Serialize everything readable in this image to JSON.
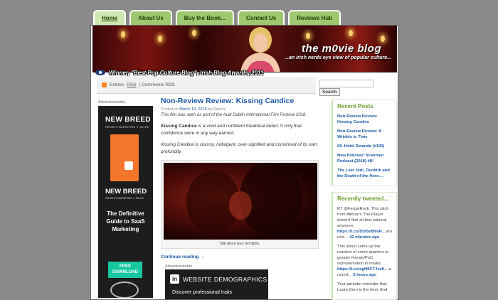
{
  "nav": {
    "tabs": [
      {
        "label": "Home",
        "active": true
      },
      {
        "label": "About Us",
        "active": false
      },
      {
        "label": "Buy the Book...",
        "active": false
      },
      {
        "label": "Contact Us",
        "active": false
      },
      {
        "label": "Reviews Hub",
        "active": false
      }
    ]
  },
  "header": {
    "site_title": "the m0vie blog",
    "tagline": "...an irish nerds eye view of popular culture...",
    "award": "Winner, \"Best Pop Culture Blog\", Irish Blog Awards, 2011"
  },
  "feeds": {
    "entries_prefix": "Entries ",
    "entries_link": "RSS",
    "comments": " | Comments RSS"
  },
  "search": {
    "button": "Search",
    "value": ""
  },
  "ads": {
    "left_label": "Advertisements",
    "left": {
      "brand": "NEW BREED",
      "brand_sub": "GROWTH MARKETING ✦ SALES",
      "brand2": "NEW BREED",
      "brand2_sub": "GROWTH MARKETING ✦ SALES",
      "pitch": "The Definitive Guide to SaaS Marketing",
      "cta": "FREE DOWNLOAD"
    },
    "bottom_label": "Advertisements",
    "bottom": {
      "logo": "in",
      "headline": "WEBSITE DEMOGRAPHICS",
      "sub": "Discover professional traits"
    }
  },
  "post": {
    "title": "Non-Review Review: Kissing Candice",
    "meta_prefix": "Posted on ",
    "date": "March 13, 2018",
    "meta_by": " by ",
    "author": "Darren",
    "note": "This film was seen as part of the Audi Dublin International Film Festival 2018.",
    "p1_strong": "Kissing Candice",
    "p1_rest": " is a vivid and confident theatrical debut. If only that confidence were in any way earned.",
    "p2_em": "Kissing Candice",
    "p2_rest": " is clumsy, indulgent, over-signified and convinced of its own profundity.",
    "caption": "Talk about your red lights.",
    "continue": "Continue reading",
    "continue_suffix": "→"
  },
  "sidebar": {
    "recent_title": "Recent Posts",
    "recent": [
      "Non-Review Review: Kissing Candice",
      "Non-Review Review: A Wrinkle in Time",
      "69. Hotel Rwanda (#190)",
      "New Podcast! Scannain Podcast (2018) #8!",
      "The Last Jedi, Dunkirk and the Death of the Hero…"
    ],
    "tweets_title": "Recently tweeted…",
    "tweets": [
      {
        "text": "RT @FergalRock: This pitch from Altman's The Player doesn't feel all that satirical anymore. ",
        "link": "https://t.co/SSiSnB9sR…",
        "tail": "aro und… ",
        "time": "42 minutes ago"
      },
      {
        "text": "This about sums up the reaction of some quarters to greater female/PoC representation in media. ",
        "link": "https://t.co/egH8CTJezK…",
        "tail": "a round… ",
        "time": "2 hours ago"
      },
      {
        "text": "Your periodic reminder that Laura Dern is the best. And",
        "link": "",
        "tail": "",
        "time": ""
      }
    ]
  }
}
